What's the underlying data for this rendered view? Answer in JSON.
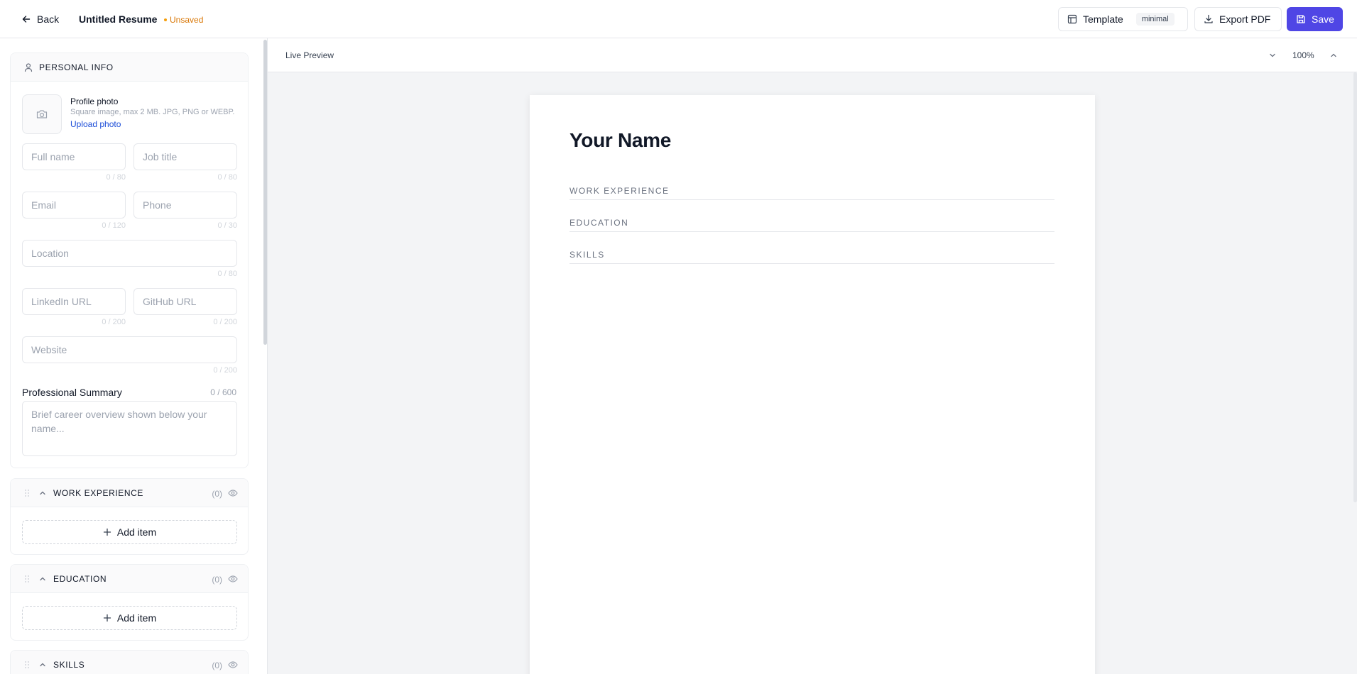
{
  "header": {
    "back_label": "Back",
    "doc_title": "Untitled Resume",
    "status": "Unsaved",
    "template_label": "Template",
    "template_value": "minimal",
    "export_label": "Export PDF",
    "save_label": "Save"
  },
  "personal": {
    "section_title": "PERSONAL INFO",
    "photo": {
      "label": "Profile photo",
      "hint": "Square image, max 2 MB. JPG, PNG or WEBP.",
      "upload_label": "Upload photo"
    },
    "fields": {
      "full_name": {
        "placeholder": "Full name",
        "counter": "0 / 80"
      },
      "job_title": {
        "placeholder": "Job title",
        "counter": "0 / 80"
      },
      "email": {
        "placeholder": "Email",
        "counter": "0 / 120"
      },
      "phone": {
        "placeholder": "Phone",
        "counter": "0 / 30"
      },
      "location": {
        "placeholder": "Location",
        "counter": "0 / 80"
      },
      "linkedin": {
        "placeholder": "LinkedIn URL",
        "counter": "0 / 200"
      },
      "github": {
        "placeholder": "GitHub URL",
        "counter": "0 / 200"
      },
      "website": {
        "placeholder": "Website",
        "counter": "0 / 200"
      }
    },
    "summary": {
      "label": "Professional Summary",
      "counter": "0 / 600",
      "placeholder": "Brief career overview shown below your name..."
    }
  },
  "sections": [
    {
      "title": "WORK EXPERIENCE",
      "count": "(0)",
      "add_label": "Add item"
    },
    {
      "title": "EDUCATION",
      "count": "(0)",
      "add_label": "Add item"
    },
    {
      "title": "SKILLS",
      "count": "(0)"
    }
  ],
  "preview": {
    "label": "Live Preview",
    "zoom": "100%",
    "resume_name": "Your Name",
    "sections": [
      "WORK EXPERIENCE",
      "EDUCATION",
      "SKILLS"
    ]
  },
  "colors": {
    "primary": "#4f46e5",
    "unsaved": "#d97706",
    "link": "#1d4ed8",
    "preview_bg": "#f3f4f6"
  }
}
